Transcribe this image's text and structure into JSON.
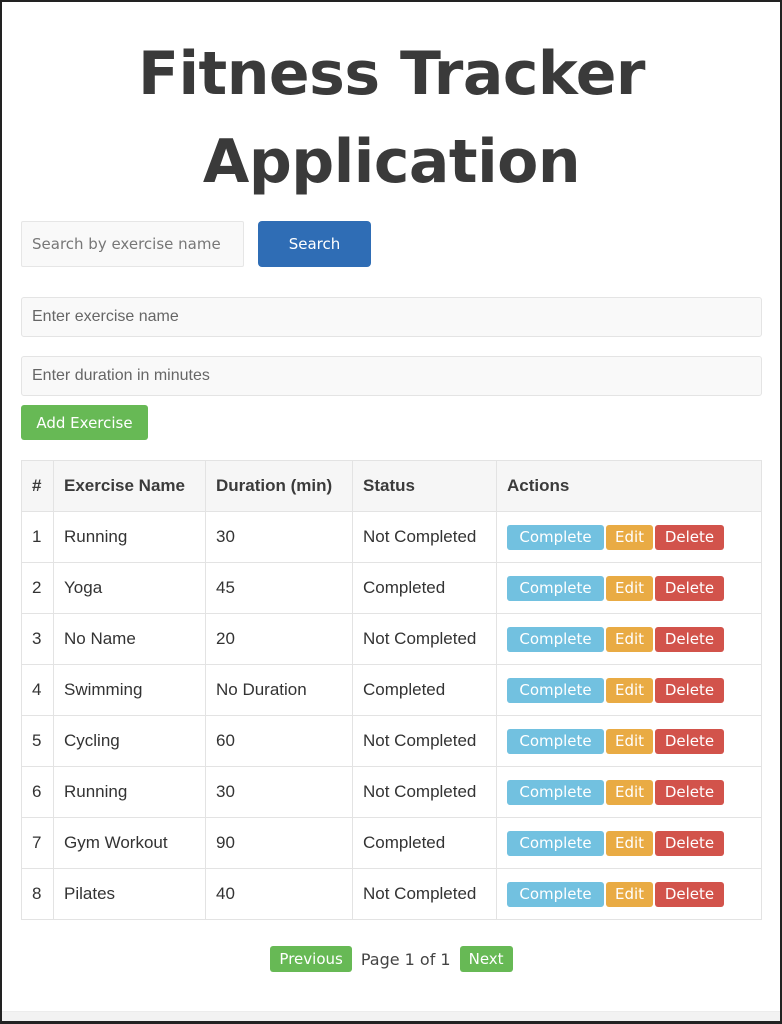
{
  "header": {
    "title": "Fitness Tracker Application"
  },
  "search": {
    "placeholder": "Search by exercise name",
    "value": "",
    "button_label": "Search"
  },
  "form": {
    "name_placeholder": "Enter exercise name",
    "duration_placeholder": "Enter duration in minutes",
    "add_button_label": "Add Exercise"
  },
  "table": {
    "headers": [
      "#",
      "Exercise Name",
      "Duration (min)",
      "Status",
      "Actions"
    ],
    "action_labels": {
      "complete": "Complete",
      "edit": "Edit",
      "delete": "Delete"
    },
    "rows": [
      {
        "num": "1",
        "name": "Running",
        "duration": "30",
        "status": "Not Completed"
      },
      {
        "num": "2",
        "name": "Yoga",
        "duration": "45",
        "status": "Completed"
      },
      {
        "num": "3",
        "name": "No Name",
        "duration": "20",
        "status": "Not Completed"
      },
      {
        "num": "4",
        "name": "Swimming",
        "duration": "No Duration",
        "status": "Completed"
      },
      {
        "num": "5",
        "name": "Cycling",
        "duration": "60",
        "status": "Not Completed"
      },
      {
        "num": "6",
        "name": "Running",
        "duration": "30",
        "status": "Not Completed"
      },
      {
        "num": "7",
        "name": "Gym Workout",
        "duration": "90",
        "status": "Completed"
      },
      {
        "num": "8",
        "name": "Pilates",
        "duration": "40",
        "status": "Not Completed"
      }
    ]
  },
  "pagination": {
    "previous_label": "Previous",
    "info": "Page 1 of 1",
    "next_label": "Next"
  },
  "colors": {
    "primary": "#2f6db5",
    "success": "#67b955",
    "info": "#72c1e0",
    "warning": "#e9ab44",
    "danger": "#d2534b",
    "title": "#3a3a3a"
  }
}
